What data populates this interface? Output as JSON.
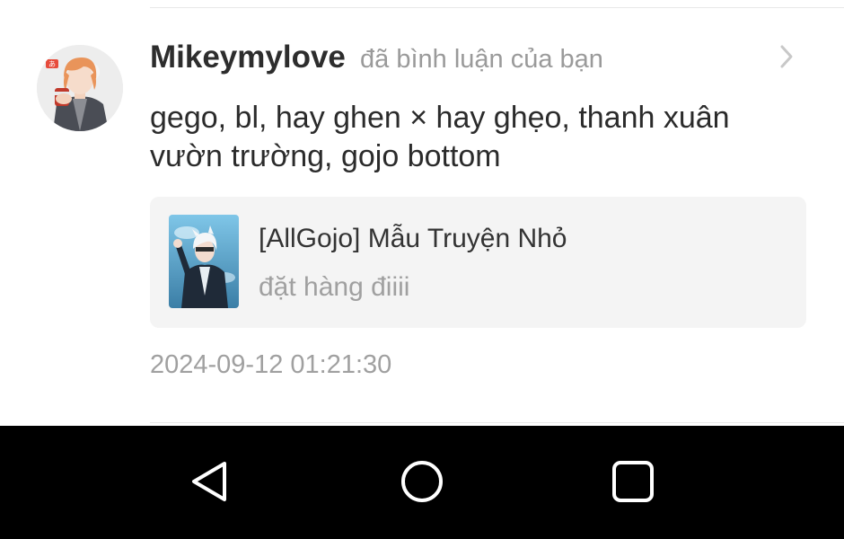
{
  "notification": {
    "username": "Mikeymylove",
    "action_text": "đã bình luận của bạn",
    "comment_text": "gego, bl, hay ghen × hay ghẹo, thanh xuân vườn trường, gojo bottom",
    "timestamp": "2024-09-12 01:21:30",
    "avatar_icon": "user-avatar-anime",
    "open_icon": "chevron-right-icon"
  },
  "story": {
    "title": "[AllGojo] Mẫu Truyện Nhỏ",
    "subtitle": "đặt hàng điiii",
    "cover_icon": "story-cover-image"
  },
  "navbar": {
    "back_icon": "back-triangle-icon",
    "home_icon": "home-circle-icon",
    "recent_icon": "recent-apps-square-icon"
  },
  "colors": {
    "username": "#2d2d2d",
    "secondary_text": "#9a9a9a",
    "card_background": "#f4f4f4",
    "navbar_background": "#000000"
  }
}
